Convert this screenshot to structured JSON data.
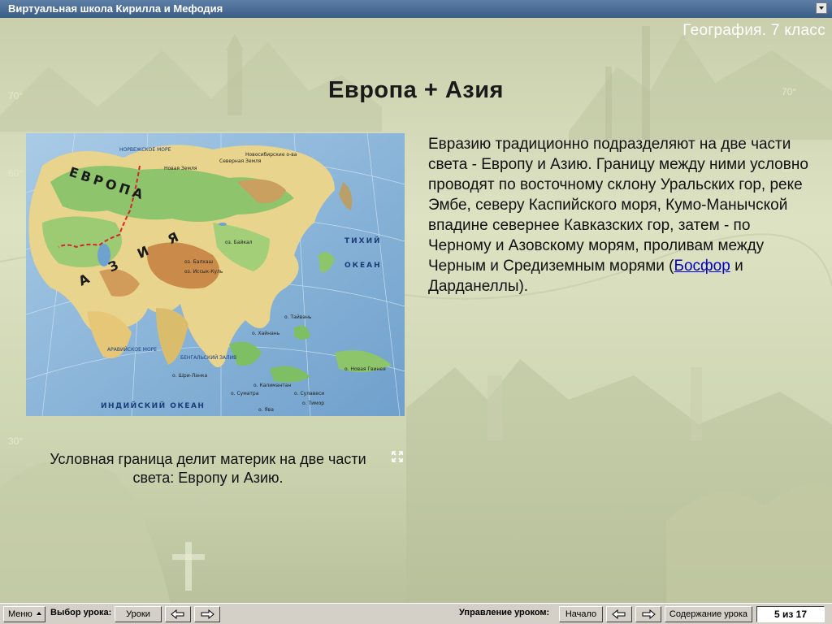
{
  "window": {
    "title": "Виртуальная школа Кирилла и Мефодия"
  },
  "header": {
    "subject": "География. 7 класс"
  },
  "lesson": {
    "title": "Европа + Азия",
    "body_before_link": "Евразию традиционно подразделяют на две части света -  Европу и Азию. Границу между ними условно проводят по восточному склону Уральских гор, реке Эмбе, северу Каспийского моря, Кумо-Манычской впадине севернее Кавказских гор, затем - по Черному и Азовскому морям, проливам между Черным и Средиземным морями (",
    "link": "Босфор",
    "body_after_link": " и Дарданеллы).",
    "caption": "Условная граница делит материк на две части света: Европу  и Азию."
  },
  "map": {
    "labels": {
      "europe": "ЕВРОПА",
      "asia": "АЗИЯ",
      "pacific": "ТИХИЙ ОКЕАН",
      "pacific_1": "ТИХИЙ",
      "pacific_2": "ОКЕАН",
      "indian": "ИНДИЙСКИЙ ОКЕАН",
      "arabian": "АРАВИЙСКОЕ МОРЕ",
      "bengal": "БЕНГАЛЬСКИЙ ЗАЛИВ",
      "norwegian": "НОРВЕЖСКОЕ МОРЕ",
      "novaya_zemlya": "Новая Земля",
      "severnaya_zemlya": "Северная Земля",
      "novosibirsk": "Новосибирские о-ва",
      "baikal": "оз. Байкал",
      "balkhash": "оз. Балхаш",
      "issyk_kul": "оз. Иссык-Куль",
      "taiwan": "о. Тайвань",
      "hainan": "о. Хайнань",
      "sri_lanka": "о. Шри-Ланка",
      "kalimantan": "о. Калимантан",
      "sulawesi": "о. Сулавеси",
      "timor": "о. Тимор",
      "java": "о. Ява",
      "new_guinea": "о. Новая Гвинея",
      "sumatra": "о. Суматра"
    }
  },
  "toolbar": {
    "menu_label": "Меню",
    "lesson_select_label": "Выбор урока:",
    "lessons_button": "Уроки",
    "lesson_control_label": "Управление уроком:",
    "start_button": "Начало",
    "contents_button": "Содержание урока",
    "counter": "5 из 17"
  }
}
